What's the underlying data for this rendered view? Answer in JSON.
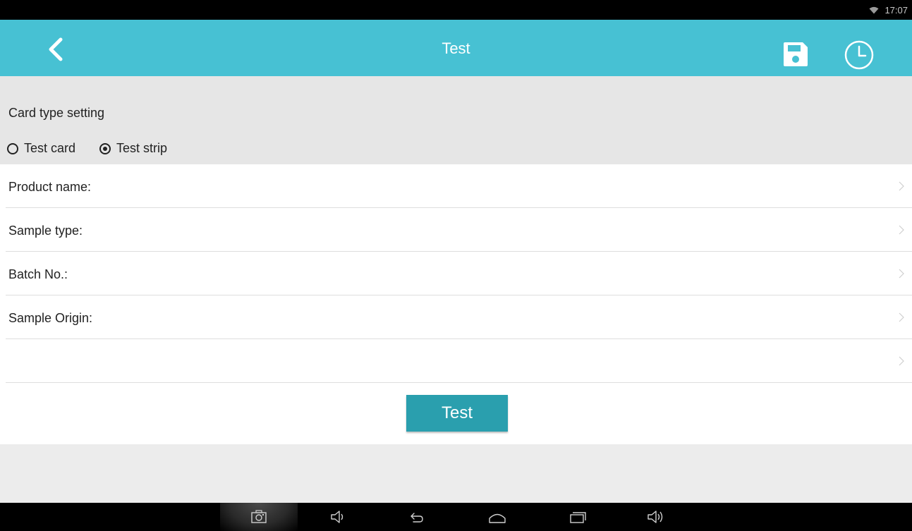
{
  "status_bar": {
    "time": "17:07",
    "wifi_icon": "wifi-icon"
  },
  "app_bar": {
    "title": "Test",
    "back_icon": "back-arrow-icon",
    "save_icon": "save-icon",
    "history_icon": "clock-icon",
    "accent_color": "#47c1d3"
  },
  "card_type": {
    "heading": "Card type setting",
    "options": [
      {
        "label": "Test card",
        "selected": false
      },
      {
        "label": "Test strip",
        "selected": true
      }
    ]
  },
  "form": {
    "rows": [
      {
        "label": "Product name:"
      },
      {
        "label": "Sample type:"
      },
      {
        "label": "Batch No.:"
      },
      {
        "label": "Sample Origin:"
      },
      {
        "label": ""
      }
    ]
  },
  "actions": {
    "test_button": "Test",
    "button_color": "#2a9fae"
  },
  "system_nav": {
    "buttons": [
      "screenshot-icon",
      "volume-down-icon",
      "back-icon",
      "home-icon",
      "recents-icon",
      "volume-up-icon"
    ]
  }
}
